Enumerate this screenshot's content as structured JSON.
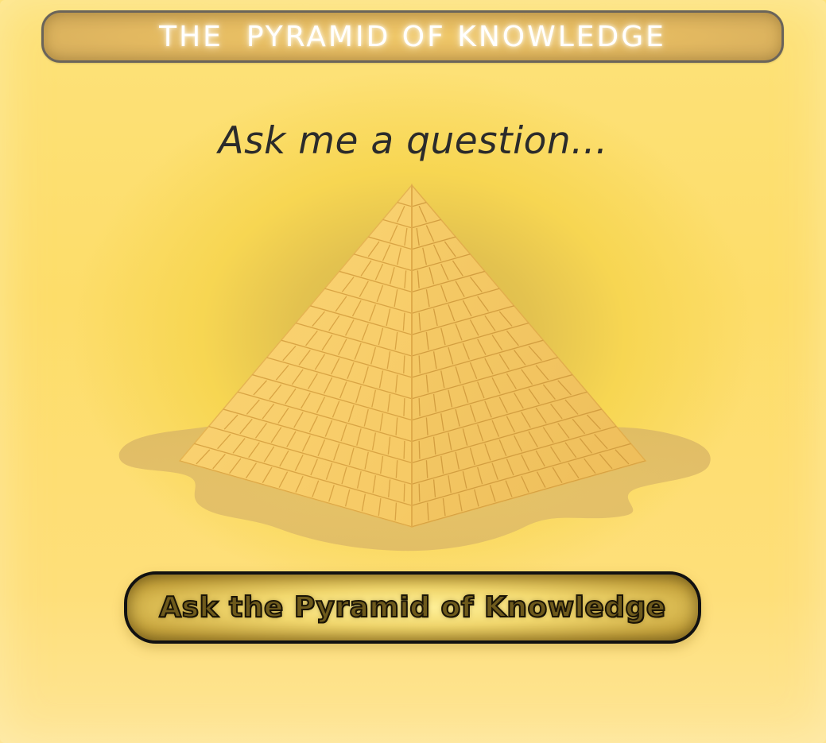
{
  "header": {
    "title": "THE  PYRAMID OF KNOWLEDGE"
  },
  "main": {
    "prompt": "Ask me a question...",
    "ask_button_label": "Ask the Pyramid of Knowledge"
  },
  "colors": {
    "background": "#fddd6a",
    "title_bar": "#e2b860",
    "title_border": "#6a645a",
    "pyramid_light": "#f8cf6e",
    "pyramid_dark": "#f0c260",
    "sand": "#e7c573",
    "button_border": "#111111"
  },
  "icons": {
    "pyramid": "pyramid-illustration"
  }
}
